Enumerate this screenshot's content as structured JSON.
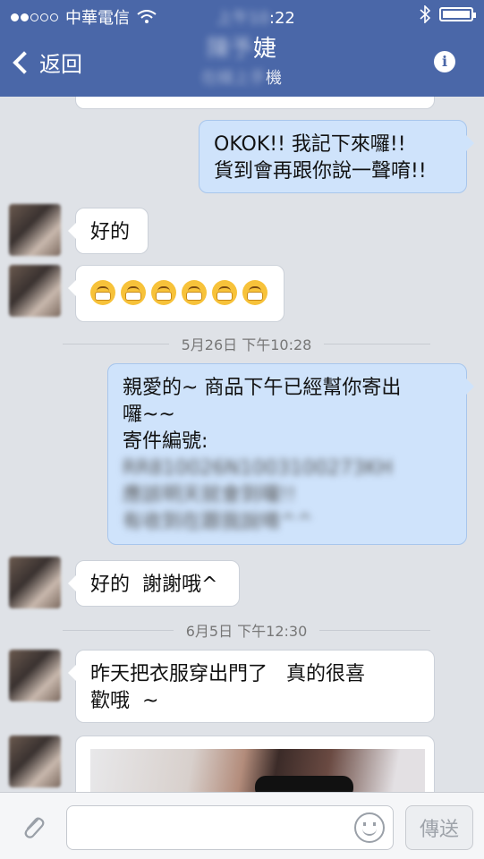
{
  "status_bar": {
    "carrier": "中華電信",
    "time": ":22",
    "signal_icon": "signal-dots-icon",
    "wifi_icon": "wifi-icon",
    "bluetooth_icon": "bluetooth-icon",
    "battery_icon": "battery-icon"
  },
  "header": {
    "back_label": "返回",
    "contact_name": "婕",
    "contact_sub": "機",
    "info_icon": "info-icon",
    "accent": "#4a67a8"
  },
  "messages": [
    {
      "side": "out",
      "lines": [
        "OKOK!! 我記下來囉!!",
        "貨到會再跟你說一聲唷!!"
      ]
    },
    {
      "side": "in",
      "text": "好的"
    },
    {
      "side": "in",
      "emoji_count": 6,
      "emoji_icon": "grinning-face-icon"
    },
    {
      "separator": "5月26日 下午10:28"
    },
    {
      "side": "out",
      "lines": [
        "親愛的~ 商品下午已經幫你寄出",
        "囉~~",
        "寄件編號:"
      ],
      "redacted_lines": [
        "RR810026N1003100273KH",
        "應該明天就會到囉!!",
        "有收到在跟我說唷^^"
      ]
    },
    {
      "side": "in",
      "text": "好的  謝謝哦^"
    },
    {
      "separator": "6月5日 下午12:30"
    },
    {
      "side": "in",
      "lines": [
        "昨天把衣服穿出門了   真的很喜",
        "歡哦  ~"
      ]
    },
    {
      "side": "in",
      "photo": true
    }
  ],
  "composer": {
    "placeholder": "",
    "send_label": "傳送",
    "attach_icon": "paperclip-icon",
    "emoji_icon": "smiley-icon"
  }
}
